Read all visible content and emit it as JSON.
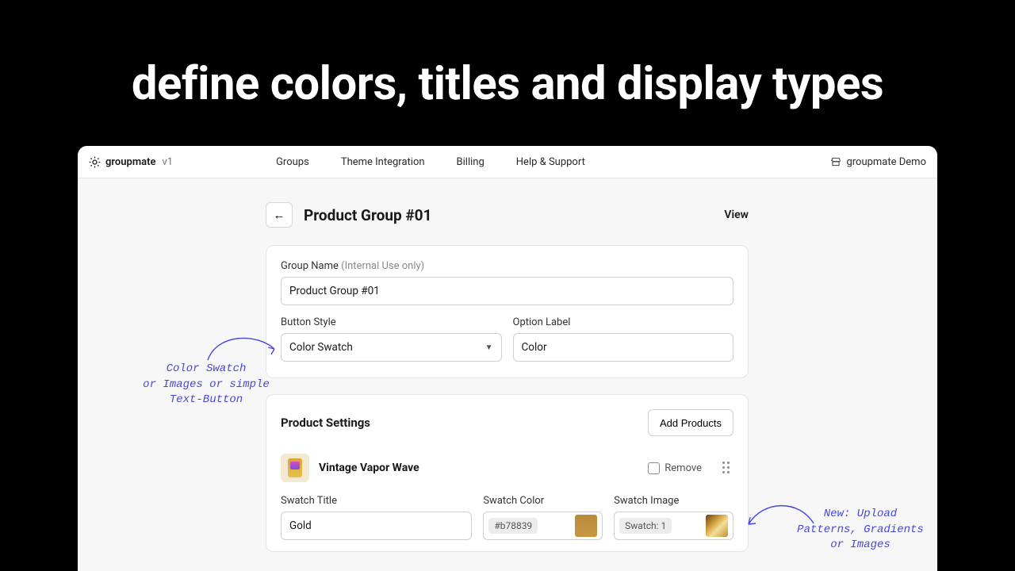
{
  "hero": "define colors, titles and display types",
  "brand": {
    "name": "groupmate",
    "version": "v1"
  },
  "nav": [
    "Groups",
    "Theme Integration",
    "Billing",
    "Help & Support"
  ],
  "shop": "groupmate Demo",
  "page": {
    "title": "Product Group #01",
    "view": "View"
  },
  "form": {
    "groupName": {
      "label": "Group Name",
      "hint": "(Internal Use only)",
      "value": "Product Group #01"
    },
    "buttonStyle": {
      "label": "Button Style",
      "value": "Color Swatch"
    },
    "optionLabel": {
      "label": "Option Label",
      "value": "Color"
    }
  },
  "settings": {
    "title": "Product Settings",
    "add": "Add Products",
    "product": {
      "name": "Vintage Vapor Wave"
    },
    "remove": "Remove",
    "swatchTitle": {
      "label": "Swatch Title",
      "value": "Gold"
    },
    "swatchColor": {
      "label": "Swatch Color",
      "chip": "#b78839"
    },
    "swatchImage": {
      "label": "Swatch Image",
      "chip": "Swatch: 1"
    }
  },
  "annotations": {
    "left": "Color Swatch\nor Images or simple\nText-Button",
    "right": "New: Upload\nPatterns, Gradients\nor Images"
  }
}
